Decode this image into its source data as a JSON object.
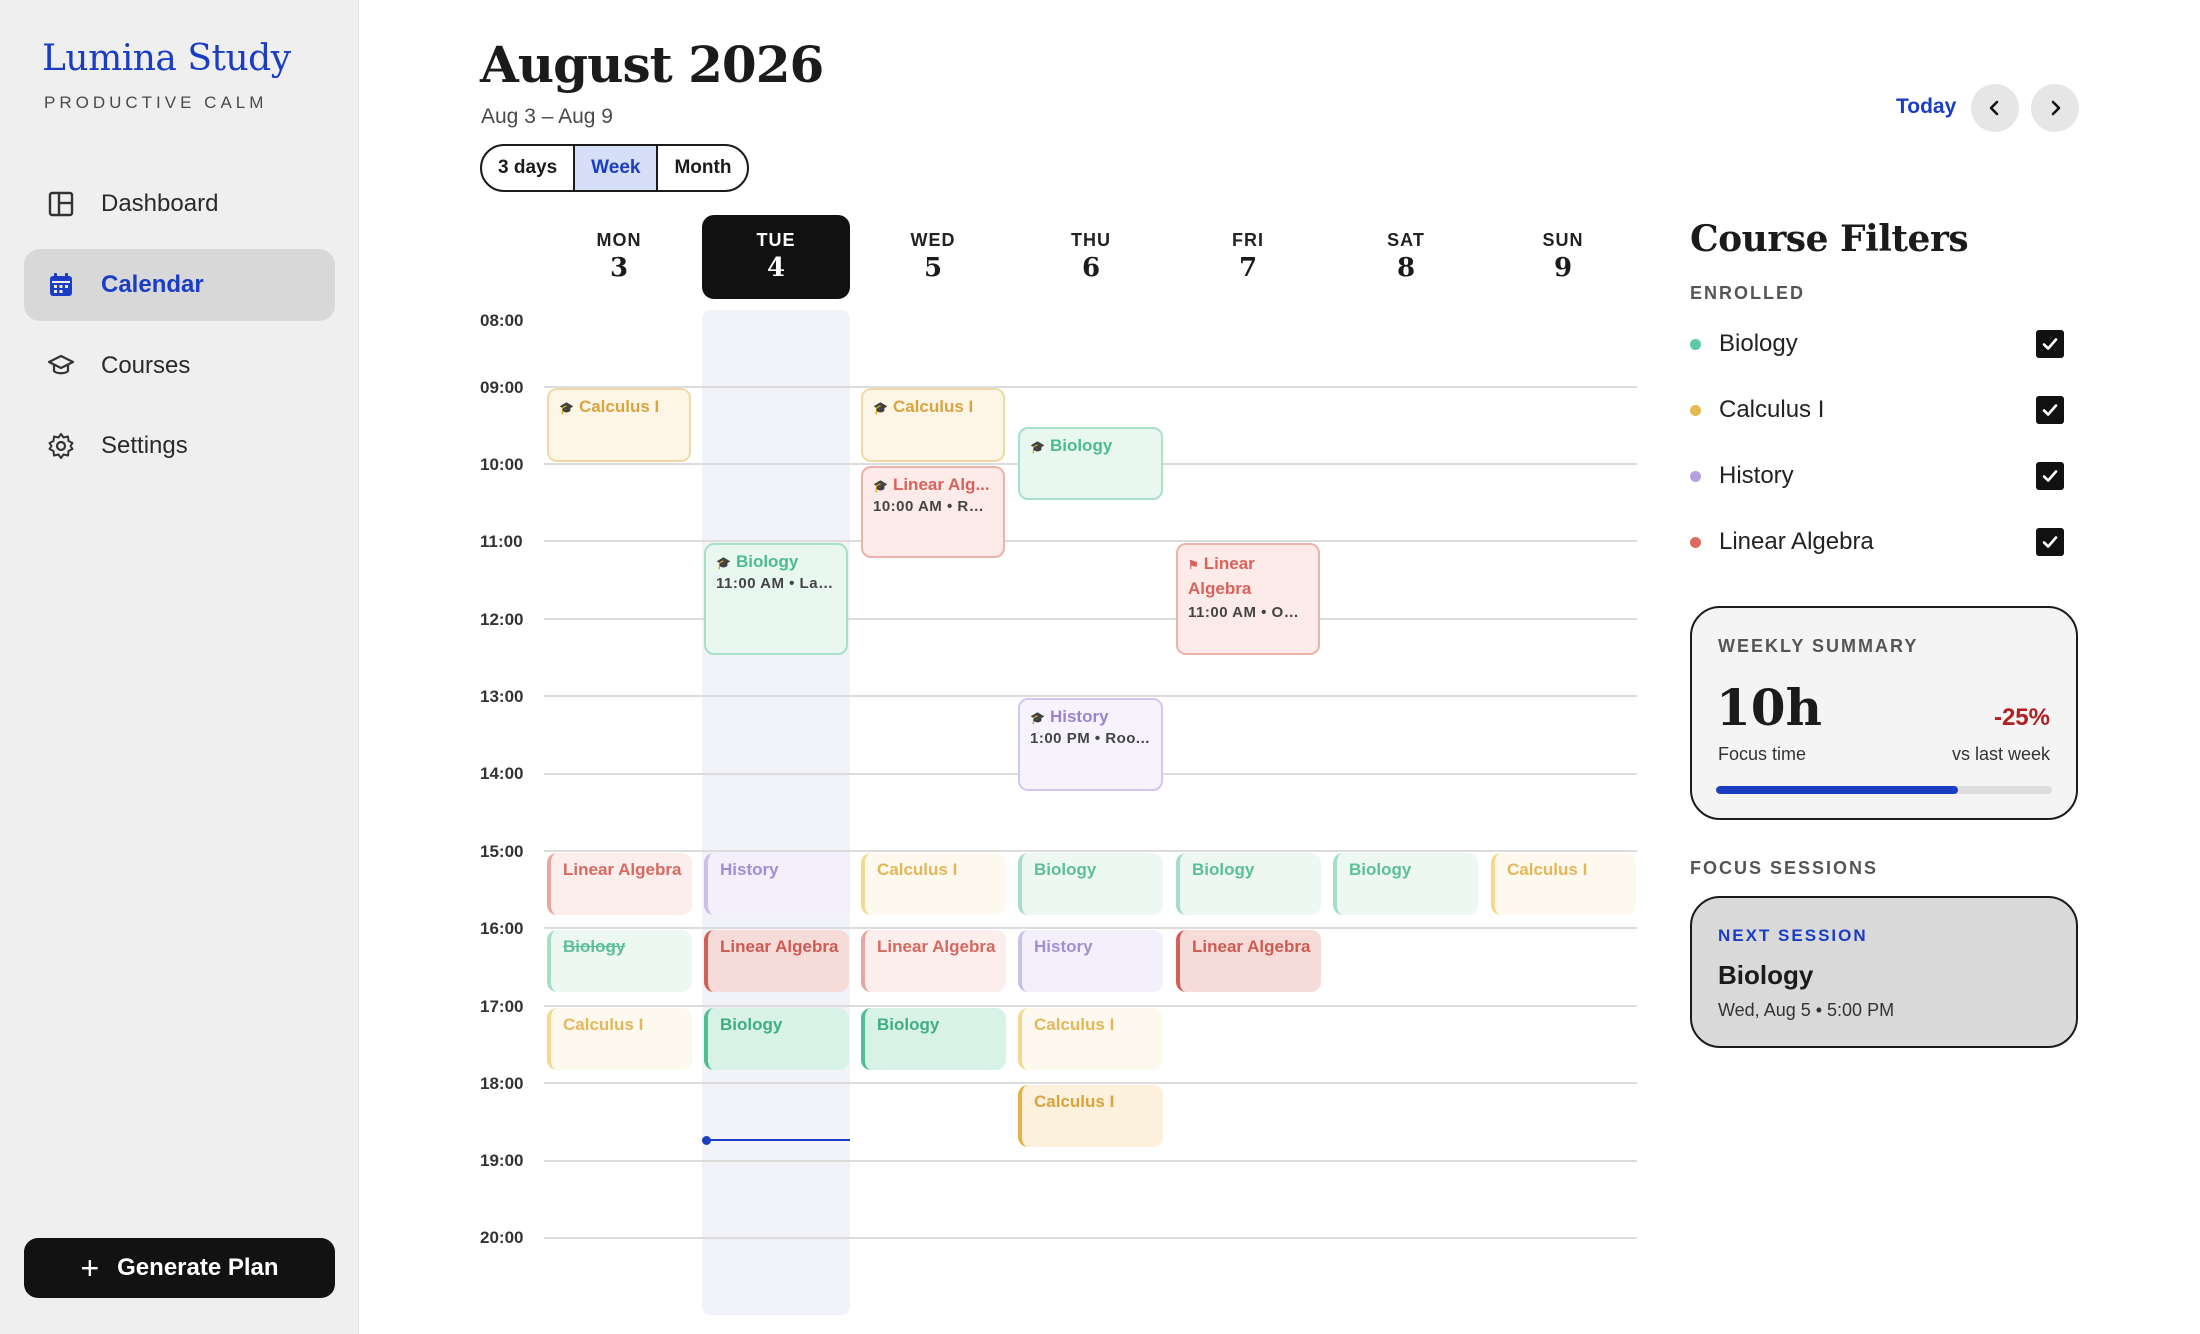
{
  "sidebar": {
    "brand": "Lumina Study",
    "tagline": "PRODUCTIVE CALM",
    "items": [
      {
        "label": "Dashboard",
        "icon": "dashboard-icon"
      },
      {
        "label": "Calendar",
        "icon": "calendar-icon",
        "active": true
      },
      {
        "label": "Courses",
        "icon": "graduation-cap-icon"
      },
      {
        "label": "Settings",
        "icon": "gear-icon"
      }
    ],
    "generate_label": "Generate Plan"
  },
  "header": {
    "title": "August 2026",
    "range": "Aug 3 – Aug 9",
    "views": [
      "3 days",
      "Week",
      "Month"
    ],
    "selected_view": "Week",
    "today_label": "Today"
  },
  "calendar": {
    "days": [
      {
        "name": "MON",
        "num": "3"
      },
      {
        "name": "TUE",
        "num": "4",
        "today": true
      },
      {
        "name": "WED",
        "num": "5"
      },
      {
        "name": "THU",
        "num": "6"
      },
      {
        "name": "FRI",
        "num": "7"
      },
      {
        "name": "SAT",
        "num": "8"
      },
      {
        "name": "SUN",
        "num": "9"
      }
    ],
    "hours": [
      "08:00",
      "09:00",
      "10:00",
      "11:00",
      "12:00",
      "13:00",
      "14:00",
      "15:00",
      "16:00",
      "17:00",
      "18:00",
      "19:00",
      "20:00"
    ],
    "classes": [
      {
        "title": "Calculus I",
        "sub": ""
      },
      {
        "title": "Calculus I",
        "sub": ""
      },
      {
        "title": "Linear Alg...",
        "sub": "10:00 AM • Roo..."
      },
      {
        "title": "Biology",
        "sub": ""
      },
      {
        "title": "Biology",
        "sub": "11:00 AM • Lab..."
      },
      {
        "title": "Linear Algebra",
        "sub": "11:00 AM • Onl..."
      },
      {
        "title": "History",
        "sub": "1:00 PM • Roo..."
      }
    ],
    "sessions": [
      {
        "title": "Linear Algebra"
      },
      {
        "title": "History"
      },
      {
        "title": "Calculus I"
      },
      {
        "title": "Biology"
      },
      {
        "title": "Biology"
      },
      {
        "title": "Biology"
      },
      {
        "title": "Calculus I"
      },
      {
        "title": "Biology"
      },
      {
        "title": "Linear Algebra"
      },
      {
        "title": "Linear Algebra"
      },
      {
        "title": "History"
      },
      {
        "title": "Linear Algebra"
      },
      {
        "title": "Calculus I"
      },
      {
        "title": "Biology"
      },
      {
        "title": "Biology"
      },
      {
        "title": "Calculus I"
      },
      {
        "title": "Calculus I"
      }
    ]
  },
  "filters": {
    "title": "Course Filters",
    "enrolled_label": "ENROLLED",
    "courses": [
      {
        "name": "Biology",
        "color": "#5cc9a0",
        "checked": true
      },
      {
        "name": "Calculus I",
        "color": "#e6b84f",
        "checked": true
      },
      {
        "name": "History",
        "color": "#b2a0e3",
        "checked": true
      },
      {
        "name": "Linear Algebra",
        "color": "#e06a5f",
        "checked": true
      }
    ]
  },
  "summary": {
    "label": "WEEKLY SUMMARY",
    "value": "10h",
    "focus_label": "Focus time",
    "change": "-25%",
    "vs_label": "vs last week",
    "progress": 0.72
  },
  "focus": {
    "label": "FOCUS SESSIONS",
    "next_label": "NEXT SESSION",
    "next_title": "Biology",
    "next_time": "Wed, Aug 5 • 5:00 PM"
  },
  "colors": {
    "accent": "#1a3dc4",
    "negative": "#b02020"
  }
}
